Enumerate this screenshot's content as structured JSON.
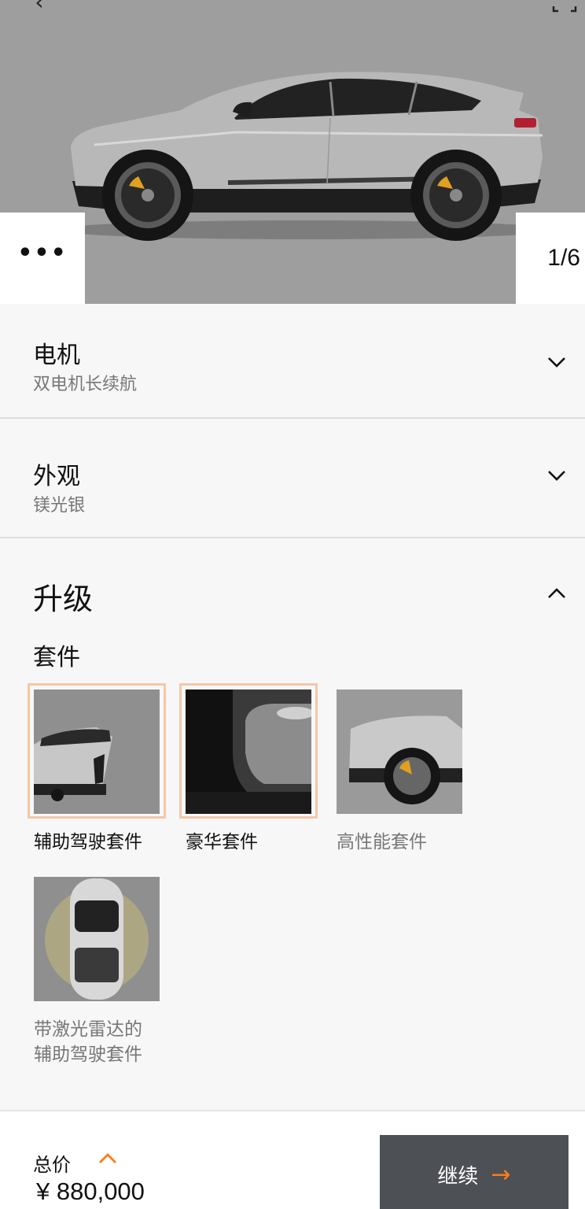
{
  "gallery": {
    "counter": "1/6",
    "more_label": "•••"
  },
  "motor": {
    "title": "电机",
    "value": "双电机长续航"
  },
  "exterior": {
    "title": "外观",
    "value": "镁光银"
  },
  "upgrades": {
    "title": "升级",
    "kits_heading": "套件",
    "kits": [
      {
        "label": "辅助驾驶套件",
        "selected": true
      },
      {
        "label": "豪华套件",
        "selected": true
      },
      {
        "label": "高性能套件",
        "selected": false
      },
      {
        "label_line1": "带激光雷达的",
        "label_line2": "辅助驾驶套件",
        "selected": false
      }
    ]
  },
  "footer": {
    "total_label": "总价",
    "price": "¥ 880,000",
    "continue_label": "继续",
    "continue_arrow": "→"
  },
  "colors": {
    "accent": "#ff7b1a",
    "selected_border": "#f4c8a8",
    "button_bg": "#4d5054",
    "hero_bg": "#9e9e9e"
  }
}
